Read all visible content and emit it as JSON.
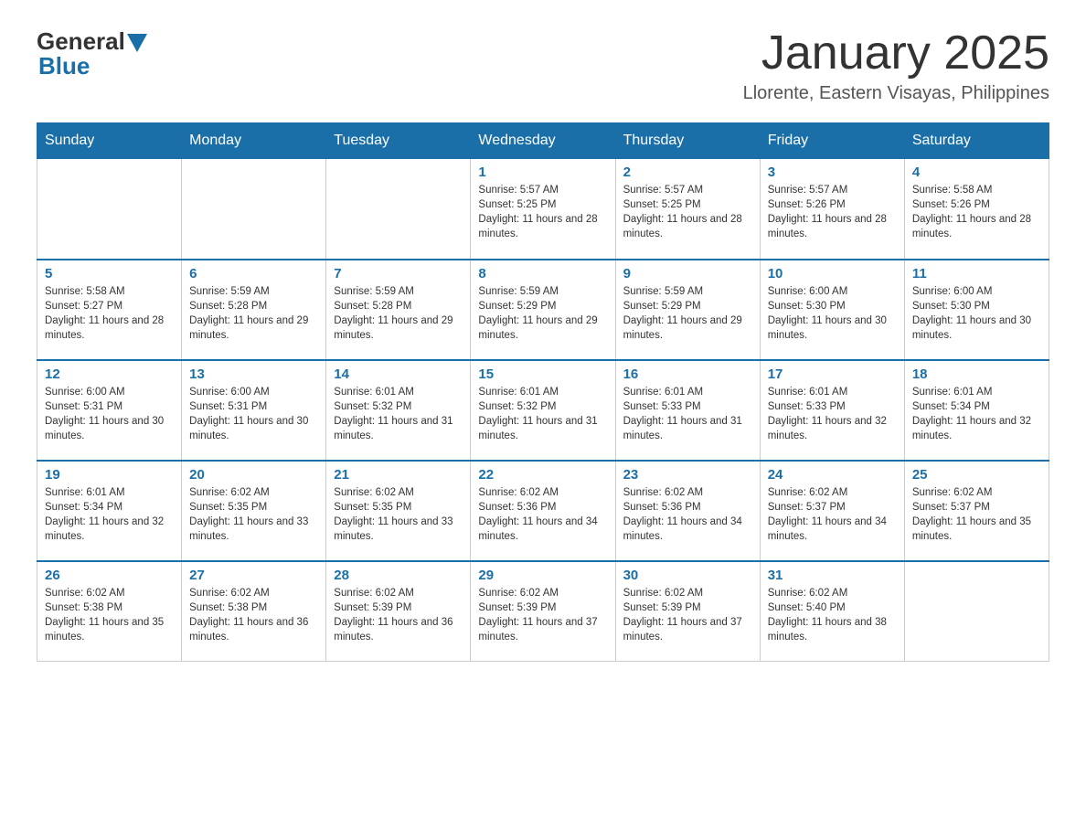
{
  "header": {
    "logo_general": "General",
    "logo_blue": "Blue",
    "month_title": "January 2025",
    "location": "Llorente, Eastern Visayas, Philippines"
  },
  "days_of_week": [
    "Sunday",
    "Monday",
    "Tuesday",
    "Wednesday",
    "Thursday",
    "Friday",
    "Saturday"
  ],
  "weeks": [
    [
      {
        "day": "",
        "info": ""
      },
      {
        "day": "",
        "info": ""
      },
      {
        "day": "",
        "info": ""
      },
      {
        "day": "1",
        "info": "Sunrise: 5:57 AM\nSunset: 5:25 PM\nDaylight: 11 hours and 28 minutes."
      },
      {
        "day": "2",
        "info": "Sunrise: 5:57 AM\nSunset: 5:25 PM\nDaylight: 11 hours and 28 minutes."
      },
      {
        "day": "3",
        "info": "Sunrise: 5:57 AM\nSunset: 5:26 PM\nDaylight: 11 hours and 28 minutes."
      },
      {
        "day": "4",
        "info": "Sunrise: 5:58 AM\nSunset: 5:26 PM\nDaylight: 11 hours and 28 minutes."
      }
    ],
    [
      {
        "day": "5",
        "info": "Sunrise: 5:58 AM\nSunset: 5:27 PM\nDaylight: 11 hours and 28 minutes."
      },
      {
        "day": "6",
        "info": "Sunrise: 5:59 AM\nSunset: 5:28 PM\nDaylight: 11 hours and 29 minutes."
      },
      {
        "day": "7",
        "info": "Sunrise: 5:59 AM\nSunset: 5:28 PM\nDaylight: 11 hours and 29 minutes."
      },
      {
        "day": "8",
        "info": "Sunrise: 5:59 AM\nSunset: 5:29 PM\nDaylight: 11 hours and 29 minutes."
      },
      {
        "day": "9",
        "info": "Sunrise: 5:59 AM\nSunset: 5:29 PM\nDaylight: 11 hours and 29 minutes."
      },
      {
        "day": "10",
        "info": "Sunrise: 6:00 AM\nSunset: 5:30 PM\nDaylight: 11 hours and 30 minutes."
      },
      {
        "day": "11",
        "info": "Sunrise: 6:00 AM\nSunset: 5:30 PM\nDaylight: 11 hours and 30 minutes."
      }
    ],
    [
      {
        "day": "12",
        "info": "Sunrise: 6:00 AM\nSunset: 5:31 PM\nDaylight: 11 hours and 30 minutes."
      },
      {
        "day": "13",
        "info": "Sunrise: 6:00 AM\nSunset: 5:31 PM\nDaylight: 11 hours and 30 minutes."
      },
      {
        "day": "14",
        "info": "Sunrise: 6:01 AM\nSunset: 5:32 PM\nDaylight: 11 hours and 31 minutes."
      },
      {
        "day": "15",
        "info": "Sunrise: 6:01 AM\nSunset: 5:32 PM\nDaylight: 11 hours and 31 minutes."
      },
      {
        "day": "16",
        "info": "Sunrise: 6:01 AM\nSunset: 5:33 PM\nDaylight: 11 hours and 31 minutes."
      },
      {
        "day": "17",
        "info": "Sunrise: 6:01 AM\nSunset: 5:33 PM\nDaylight: 11 hours and 32 minutes."
      },
      {
        "day": "18",
        "info": "Sunrise: 6:01 AM\nSunset: 5:34 PM\nDaylight: 11 hours and 32 minutes."
      }
    ],
    [
      {
        "day": "19",
        "info": "Sunrise: 6:01 AM\nSunset: 5:34 PM\nDaylight: 11 hours and 32 minutes."
      },
      {
        "day": "20",
        "info": "Sunrise: 6:02 AM\nSunset: 5:35 PM\nDaylight: 11 hours and 33 minutes."
      },
      {
        "day": "21",
        "info": "Sunrise: 6:02 AM\nSunset: 5:35 PM\nDaylight: 11 hours and 33 minutes."
      },
      {
        "day": "22",
        "info": "Sunrise: 6:02 AM\nSunset: 5:36 PM\nDaylight: 11 hours and 34 minutes."
      },
      {
        "day": "23",
        "info": "Sunrise: 6:02 AM\nSunset: 5:36 PM\nDaylight: 11 hours and 34 minutes."
      },
      {
        "day": "24",
        "info": "Sunrise: 6:02 AM\nSunset: 5:37 PM\nDaylight: 11 hours and 34 minutes."
      },
      {
        "day": "25",
        "info": "Sunrise: 6:02 AM\nSunset: 5:37 PM\nDaylight: 11 hours and 35 minutes."
      }
    ],
    [
      {
        "day": "26",
        "info": "Sunrise: 6:02 AM\nSunset: 5:38 PM\nDaylight: 11 hours and 35 minutes."
      },
      {
        "day": "27",
        "info": "Sunrise: 6:02 AM\nSunset: 5:38 PM\nDaylight: 11 hours and 36 minutes."
      },
      {
        "day": "28",
        "info": "Sunrise: 6:02 AM\nSunset: 5:39 PM\nDaylight: 11 hours and 36 minutes."
      },
      {
        "day": "29",
        "info": "Sunrise: 6:02 AM\nSunset: 5:39 PM\nDaylight: 11 hours and 37 minutes."
      },
      {
        "day": "30",
        "info": "Sunrise: 6:02 AM\nSunset: 5:39 PM\nDaylight: 11 hours and 37 minutes."
      },
      {
        "day": "31",
        "info": "Sunrise: 6:02 AM\nSunset: 5:40 PM\nDaylight: 11 hours and 38 minutes."
      },
      {
        "day": "",
        "info": ""
      }
    ]
  ]
}
